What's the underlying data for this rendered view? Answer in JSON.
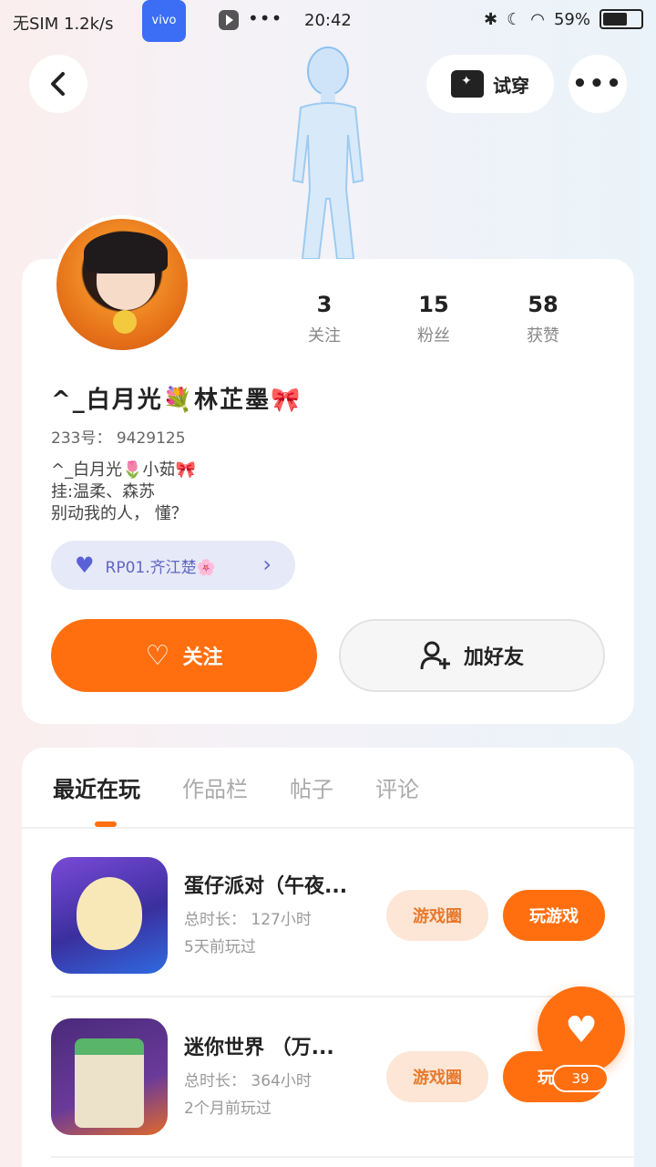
{
  "status_bar": {
    "carrier": "无SIM 1.2k/s",
    "vivo_label": "vivo",
    "time": "20:42",
    "battery": "59%"
  },
  "header": {
    "try_on_label": "试穿"
  },
  "profile": {
    "nickname": "^_白月光💐林芷墨🎀",
    "uid": "233号： 9429125",
    "bio": "^_白月光🌷小茹🎀\n挂:温柔、森苏\n别动我的人， 懂？",
    "stats": [
      {
        "value": "3",
        "label": "关注"
      },
      {
        "value": "15",
        "label": "粉丝"
      },
      {
        "value": "58",
        "label": "获赞"
      }
    ],
    "relation_pill": "RP01.齐江楚🌸",
    "follow_label": "关注",
    "add_friend_label": "加好友"
  },
  "tabs": [
    {
      "label": "最近在玩",
      "active": true
    },
    {
      "label": "作品栏",
      "active": false
    },
    {
      "label": "帖子",
      "active": false
    },
    {
      "label": "评论",
      "active": false
    }
  ],
  "games": [
    {
      "title": "蛋仔派对（午夜...",
      "duration": "总时长： 127小时",
      "last_played": "5天前玩过",
      "circle_label": "游戏圈",
      "play_label": "玩游戏"
    },
    {
      "title": "迷你世界 （万...",
      "duration": "总时长： 364小时",
      "last_played": "2个月前玩过",
      "circle_label": "游戏圈",
      "play_label": "玩游"
    }
  ],
  "fab": {
    "count": "39"
  },
  "colors": {
    "accent": "#ff6f10",
    "circle_bg": "#fde6d5",
    "pill_bg": "#e6e9f7"
  }
}
